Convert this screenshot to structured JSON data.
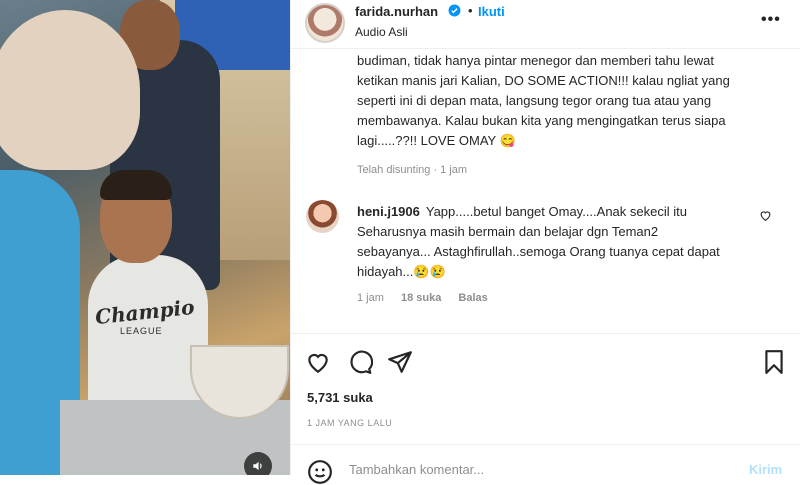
{
  "post": {
    "username": "farida.nurhan",
    "follow_label": "Ikuti",
    "separator": "•",
    "audio": "Audio Asli",
    "more_icon": "more-horizontal-icon",
    "caption_lines": [
      "budiman, tidak hanya pintar menegor dan memberi tahu lewat",
      "ketikan manis jari Kalian, DO SOME ACTION!!! kalau ngliat yang",
      "seperti ini di depan mata, langsung tegor orang tua atau yang",
      "membawanya. Kalau bukan kita yang mengingatkan terus siapa",
      "lagi.....??!! LOVE OMAY 😋"
    ],
    "caption_meta": "Telah disunting · 1 jam"
  },
  "media": {
    "shirt_text": "Champio",
    "shirt_subtext": "LEAGUE",
    "sound_icon": "speaker-icon"
  },
  "comment": {
    "username": "heni.j1906",
    "text_lines": [
      "Yapp.....betul banget Omay....Anak sekecil itu",
      "Seharusnya masih bermain dan belajar dgn Teman2",
      "sebayanya... Astaghfirullah..semoga Orang tuanya cepat dapat",
      "hidayah...😢😢"
    ],
    "time": "1 jam",
    "likes": "18 suka",
    "reply": "Balas"
  },
  "actions": {
    "likes": "5,731 suka",
    "timestamp": "1 JAM YANG LALU"
  },
  "comment_bar": {
    "placeholder": "Tambahkan komentar...",
    "send_label": "Kirim"
  },
  "colors": {
    "accent": "#0095f6",
    "send_disabled": "#b2dffc",
    "muted": "#8e8e8e"
  }
}
